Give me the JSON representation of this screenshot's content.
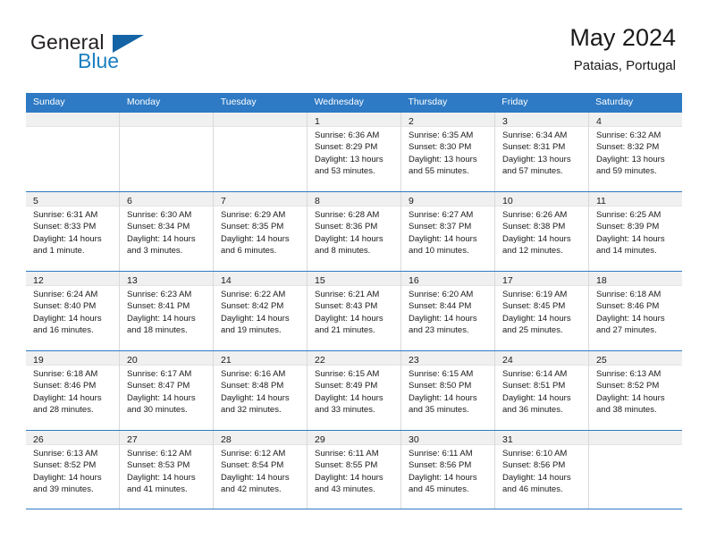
{
  "logo": {
    "word1": "General",
    "word2": "Blue",
    "triangle_color": "#1464a5",
    "blue_color": "#1a7fc1"
  },
  "header": {
    "title": "May 2024",
    "subtitle": "Pataias, Portugal"
  },
  "theme": {
    "header_blue": "#2e7ac4",
    "cell_head_gray": "#f0f0f0",
    "grid_line": "#d9d9d9"
  },
  "weekdays": [
    "Sunday",
    "Monday",
    "Tuesday",
    "Wednesday",
    "Thursday",
    "Friday",
    "Saturday"
  ],
  "labels": {
    "sunrise": "Sunrise:",
    "sunset": "Sunset:",
    "daylight": "Daylight:"
  },
  "weeks": [
    [
      {
        "day": "",
        "empty": true
      },
      {
        "day": "",
        "empty": true
      },
      {
        "day": "",
        "empty": true
      },
      {
        "day": "1",
        "sunrise": "Sunrise: 6:36 AM",
        "sunset": "Sunset: 8:29 PM",
        "daylight1": "Daylight: 13 hours",
        "daylight2": "and 53 minutes."
      },
      {
        "day": "2",
        "sunrise": "Sunrise: 6:35 AM",
        "sunset": "Sunset: 8:30 PM",
        "daylight1": "Daylight: 13 hours",
        "daylight2": "and 55 minutes."
      },
      {
        "day": "3",
        "sunrise": "Sunrise: 6:34 AM",
        "sunset": "Sunset: 8:31 PM",
        "daylight1": "Daylight: 13 hours",
        "daylight2": "and 57 minutes."
      },
      {
        "day": "4",
        "sunrise": "Sunrise: 6:32 AM",
        "sunset": "Sunset: 8:32 PM",
        "daylight1": "Daylight: 13 hours",
        "daylight2": "and 59 minutes."
      }
    ],
    [
      {
        "day": "5",
        "sunrise": "Sunrise: 6:31 AM",
        "sunset": "Sunset: 8:33 PM",
        "daylight1": "Daylight: 14 hours",
        "daylight2": "and 1 minute."
      },
      {
        "day": "6",
        "sunrise": "Sunrise: 6:30 AM",
        "sunset": "Sunset: 8:34 PM",
        "daylight1": "Daylight: 14 hours",
        "daylight2": "and 3 minutes."
      },
      {
        "day": "7",
        "sunrise": "Sunrise: 6:29 AM",
        "sunset": "Sunset: 8:35 PM",
        "daylight1": "Daylight: 14 hours",
        "daylight2": "and 6 minutes."
      },
      {
        "day": "8",
        "sunrise": "Sunrise: 6:28 AM",
        "sunset": "Sunset: 8:36 PM",
        "daylight1": "Daylight: 14 hours",
        "daylight2": "and 8 minutes."
      },
      {
        "day": "9",
        "sunrise": "Sunrise: 6:27 AM",
        "sunset": "Sunset: 8:37 PM",
        "daylight1": "Daylight: 14 hours",
        "daylight2": "and 10 minutes."
      },
      {
        "day": "10",
        "sunrise": "Sunrise: 6:26 AM",
        "sunset": "Sunset: 8:38 PM",
        "daylight1": "Daylight: 14 hours",
        "daylight2": "and 12 minutes."
      },
      {
        "day": "11",
        "sunrise": "Sunrise: 6:25 AM",
        "sunset": "Sunset: 8:39 PM",
        "daylight1": "Daylight: 14 hours",
        "daylight2": "and 14 minutes."
      }
    ],
    [
      {
        "day": "12",
        "sunrise": "Sunrise: 6:24 AM",
        "sunset": "Sunset: 8:40 PM",
        "daylight1": "Daylight: 14 hours",
        "daylight2": "and 16 minutes."
      },
      {
        "day": "13",
        "sunrise": "Sunrise: 6:23 AM",
        "sunset": "Sunset: 8:41 PM",
        "daylight1": "Daylight: 14 hours",
        "daylight2": "and 18 minutes."
      },
      {
        "day": "14",
        "sunrise": "Sunrise: 6:22 AM",
        "sunset": "Sunset: 8:42 PM",
        "daylight1": "Daylight: 14 hours",
        "daylight2": "and 19 minutes."
      },
      {
        "day": "15",
        "sunrise": "Sunrise: 6:21 AM",
        "sunset": "Sunset: 8:43 PM",
        "daylight1": "Daylight: 14 hours",
        "daylight2": "and 21 minutes."
      },
      {
        "day": "16",
        "sunrise": "Sunrise: 6:20 AM",
        "sunset": "Sunset: 8:44 PM",
        "daylight1": "Daylight: 14 hours",
        "daylight2": "and 23 minutes."
      },
      {
        "day": "17",
        "sunrise": "Sunrise: 6:19 AM",
        "sunset": "Sunset: 8:45 PM",
        "daylight1": "Daylight: 14 hours",
        "daylight2": "and 25 minutes."
      },
      {
        "day": "18",
        "sunrise": "Sunrise: 6:18 AM",
        "sunset": "Sunset: 8:46 PM",
        "daylight1": "Daylight: 14 hours",
        "daylight2": "and 27 minutes."
      }
    ],
    [
      {
        "day": "19",
        "sunrise": "Sunrise: 6:18 AM",
        "sunset": "Sunset: 8:46 PM",
        "daylight1": "Daylight: 14 hours",
        "daylight2": "and 28 minutes."
      },
      {
        "day": "20",
        "sunrise": "Sunrise: 6:17 AM",
        "sunset": "Sunset: 8:47 PM",
        "daylight1": "Daylight: 14 hours",
        "daylight2": "and 30 minutes."
      },
      {
        "day": "21",
        "sunrise": "Sunrise: 6:16 AM",
        "sunset": "Sunset: 8:48 PM",
        "daylight1": "Daylight: 14 hours",
        "daylight2": "and 32 minutes."
      },
      {
        "day": "22",
        "sunrise": "Sunrise: 6:15 AM",
        "sunset": "Sunset: 8:49 PM",
        "daylight1": "Daylight: 14 hours",
        "daylight2": "and 33 minutes."
      },
      {
        "day": "23",
        "sunrise": "Sunrise: 6:15 AM",
        "sunset": "Sunset: 8:50 PM",
        "daylight1": "Daylight: 14 hours",
        "daylight2": "and 35 minutes."
      },
      {
        "day": "24",
        "sunrise": "Sunrise: 6:14 AM",
        "sunset": "Sunset: 8:51 PM",
        "daylight1": "Daylight: 14 hours",
        "daylight2": "and 36 minutes."
      },
      {
        "day": "25",
        "sunrise": "Sunrise: 6:13 AM",
        "sunset": "Sunset: 8:52 PM",
        "daylight1": "Daylight: 14 hours",
        "daylight2": "and 38 minutes."
      }
    ],
    [
      {
        "day": "26",
        "sunrise": "Sunrise: 6:13 AM",
        "sunset": "Sunset: 8:52 PM",
        "daylight1": "Daylight: 14 hours",
        "daylight2": "and 39 minutes."
      },
      {
        "day": "27",
        "sunrise": "Sunrise: 6:12 AM",
        "sunset": "Sunset: 8:53 PM",
        "daylight1": "Daylight: 14 hours",
        "daylight2": "and 41 minutes."
      },
      {
        "day": "28",
        "sunrise": "Sunrise: 6:12 AM",
        "sunset": "Sunset: 8:54 PM",
        "daylight1": "Daylight: 14 hours",
        "daylight2": "and 42 minutes."
      },
      {
        "day": "29",
        "sunrise": "Sunrise: 6:11 AM",
        "sunset": "Sunset: 8:55 PM",
        "daylight1": "Daylight: 14 hours",
        "daylight2": "and 43 minutes."
      },
      {
        "day": "30",
        "sunrise": "Sunrise: 6:11 AM",
        "sunset": "Sunset: 8:56 PM",
        "daylight1": "Daylight: 14 hours",
        "daylight2": "and 45 minutes."
      },
      {
        "day": "31",
        "sunrise": "Sunrise: 6:10 AM",
        "sunset": "Sunset: 8:56 PM",
        "daylight1": "Daylight: 14 hours",
        "daylight2": "and 46 minutes."
      },
      {
        "day": "",
        "empty": true
      }
    ]
  ]
}
